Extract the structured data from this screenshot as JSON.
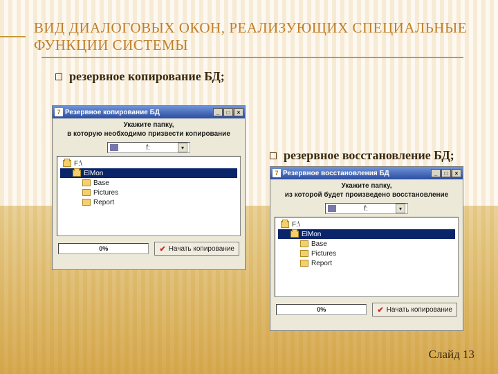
{
  "title": "ВИД ДИАЛОГОВЫХ ОКОН, РЕАЛИЗУЮЩИХ СПЕЦИАЛЬНЫЕ ФУНКЦИИ СИСТЕМЫ",
  "bullets": {
    "backup": "резервное копирование БД;",
    "restore": "резервное восстановление БД;"
  },
  "dialog_backup": {
    "title": "Резервное копирование БД",
    "instruction1": "Укажите папку,",
    "instruction2": "в которую необходимо призвести копирование",
    "drive": "f:",
    "tree": {
      "root": "F:\\",
      "selected": "ElMon",
      "children": [
        "Base",
        "Pictures",
        "Report"
      ]
    },
    "progress": "0%",
    "start_button": "Начать копирование"
  },
  "dialog_restore": {
    "title": "Резервное восстановления БД",
    "instruction1": "Укажите папку,",
    "instruction2": "из которой будет произведено восстановление",
    "drive": "f:",
    "tree": {
      "root": "F:\\",
      "selected": "ElMon",
      "children": [
        "Base",
        "Pictures",
        "Report"
      ]
    },
    "progress": "0%",
    "start_button": "Начать копирование"
  },
  "slide_number": "Слайд 13"
}
